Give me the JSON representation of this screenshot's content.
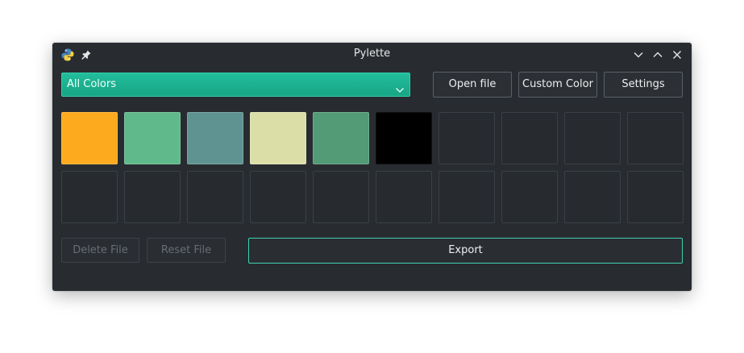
{
  "window": {
    "title": "Pylette",
    "icons": {
      "app": "python-logo-icon",
      "pin": "pin-icon",
      "minimize": "chevron-down-icon",
      "maximize": "chevron-up-icon",
      "close": "close-icon"
    }
  },
  "toolbar": {
    "filter_selected": "All Colors",
    "open_file_label": "Open file",
    "custom_color_label": "Custom Color",
    "settings_label": "Settings"
  },
  "palette": {
    "colors": [
      "#fdaa1f",
      "#5fb98a",
      "#5f9391",
      "#dbdea7",
      "#539a76",
      "#000000",
      null,
      null,
      null,
      null,
      null,
      null,
      null,
      null,
      null,
      null,
      null,
      null,
      null,
      null
    ]
  },
  "actions": {
    "delete_label": "Delete File",
    "reset_label": "Reset File",
    "export_label": "Export"
  },
  "theme": {
    "accent": "#1fb594",
    "background": "#282c30"
  }
}
